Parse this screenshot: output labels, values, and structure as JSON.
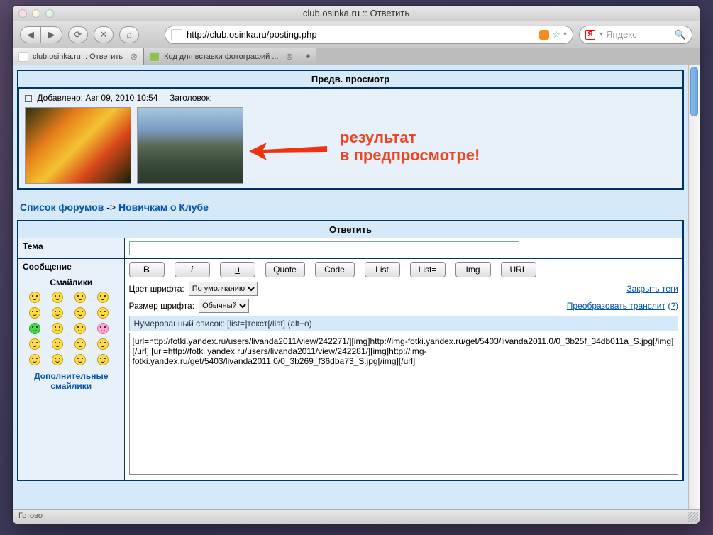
{
  "window_title": "club.osinka.ru :: Ответить",
  "url": "http://club.osinka.ru/posting.php",
  "search_placeholder": "Яндекс",
  "tabs": [
    {
      "label": "club.osinka.ru :: Ответить",
      "active": true
    },
    {
      "label": "Код для вставки фотографий ...",
      "active": false
    }
  ],
  "status_text": "Готово",
  "preview": {
    "header": "Предв. просмотр",
    "posted_label": "Добавлено:",
    "posted_date": "Авг 09, 2010 10:54",
    "subject_label": "Заголовок:",
    "annotation_line1": "результат",
    "annotation_line2": "в предпросмотре!"
  },
  "breadcrumbs": {
    "forum_list": "Список форумов",
    "sep": "->",
    "current": "Новичкам о Клубе"
  },
  "form": {
    "header": "Ответить",
    "subject_label": "Тема",
    "subject_value": "",
    "message_label": "Сообщение",
    "bb": {
      "b": "B",
      "i": "i",
      "u": "u",
      "quote": "Quote",
      "code": "Code",
      "list": "List",
      "liste": "List=",
      "img": "Img",
      "url": "URL"
    },
    "font_color_label": "Цвет шрифта:",
    "font_color_value": "По умолчанию",
    "font_size_label": "Размер шрифта:",
    "font_size_value": "Обычный",
    "close_tags": "Закрыть теги",
    "translit": "Преобразовать транслит",
    "translit_q": "(?)",
    "hint": "Нумерованный список: [list=]текст[/list]  (alt+o)",
    "message_value": "[url=http://fotki.yandex.ru/users/livanda2011/view/242271/][img]http://img-fotki.yandex.ru/get/5403/livanda2011.0/0_3b25f_34db011a_S.jpg[/img][/url] [url=http://fotki.yandex.ru/users/livanda2011/view/242281/][img]http://img-fotki.yandex.ru/get/5403/livanda2011.0/0_3b269_f36dba73_S.jpg[/img][/url]"
  },
  "smileys": {
    "title": "Смайлики",
    "more": "Дополнительные смайлики"
  }
}
